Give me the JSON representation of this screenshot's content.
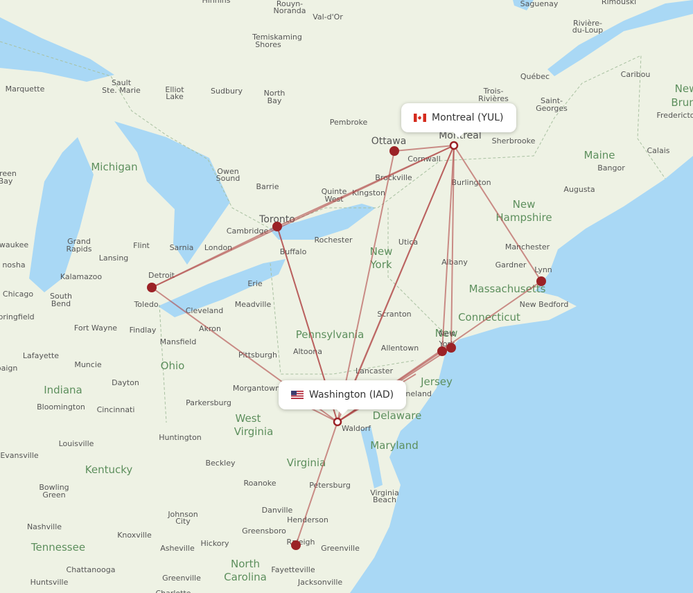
{
  "colors": {
    "land": "#eef2e4",
    "water": "#a9d8f5",
    "route": "#b04646",
    "dot": "#9b2226",
    "state_label": "#5d8f5d",
    "city_label": "#555555"
  },
  "origin": {
    "label": "Montreal (YUL)",
    "flag": "canada-flag-icon"
  },
  "destination": {
    "label": "Washington (IAD)",
    "flag": "us-flag-icon"
  },
  "states": [
    "Michigan",
    "Ohio",
    "Indiana",
    "Kentucky",
    "Tennessee",
    "West",
    "Virginia",
    "Virginia",
    "North",
    "Carolina",
    "Pennsylvania",
    "New",
    "York",
    "New",
    "Jersey",
    "Delaware",
    "Maryland",
    "Connecticut",
    "Massachusetts",
    "New",
    "Hampshire",
    "Maine",
    "New",
    "Bruns"
  ],
  "cities": [
    "Hinnins",
    "Rouyn-",
    "Noranda",
    "Val-d'Or",
    "Saguenay",
    "Rimouski",
    "Rivière-",
    "du-Loup",
    "Temiskaming",
    "Shores",
    "Marquette",
    "Sault",
    "Ste. Marie",
    "Elliot",
    "Lake",
    "Sudbury",
    "North",
    "Bay",
    "Québec",
    "Trois-",
    "Rivières",
    "Caribou",
    "Saint-",
    "Georges",
    "Fredericto",
    "Pembroke",
    "Ottawa",
    "Montreal",
    "Sherbrooke",
    "Cornwall",
    "Brockville",
    "Calais",
    "Bangor",
    "green",
    "Bay",
    "Owen",
    "Sound",
    "Barrie",
    "Quinte",
    "West",
    "Kingston",
    "Burlington",
    "Augusta",
    "Toronto",
    "Cambridge",
    "waukee",
    "Grand",
    "Rapids",
    "Flint",
    "Sarnia",
    "London",
    "Rochester",
    "Utica",
    "Manchester",
    "nosha",
    "Lansing",
    "Detroit",
    "Buffalo",
    "Albany",
    "Gardner",
    "Lynn",
    "Chicago",
    "Kalamazoo",
    "South",
    "Bend",
    "Toledo",
    "Erie",
    "Cleveland",
    "Meadville",
    "Springfield",
    "New Bedford",
    "Fort Wayne",
    "Findlay",
    "Akron",
    "Scranton",
    "Mansfield",
    "New",
    "York",
    "Allentown",
    "Lafayette",
    "Muncie",
    "Pittsburgh",
    "Altoona",
    "paign",
    "Dayton",
    "Lancaster",
    "Morgantown",
    "Vineland",
    "Bloomington",
    "Cincinnati",
    "Parkersburg",
    "Waldorf",
    "Huntington",
    "Louisville",
    "Evansville",
    "Beckley",
    "Roanoke",
    "Petersburg",
    "Bowling",
    "Green",
    "Virginia",
    "Beach",
    "Johnson",
    "City",
    "Danville",
    "Henderson",
    "Nashville",
    "Knoxville",
    "Greensboro",
    "Hickory",
    "Asheville",
    "Greenville",
    "Raleigh",
    "Fayetteville",
    "Jacksonville",
    "Chattanooga",
    "Greenville",
    "Huntsville",
    "Charlotte"
  ]
}
